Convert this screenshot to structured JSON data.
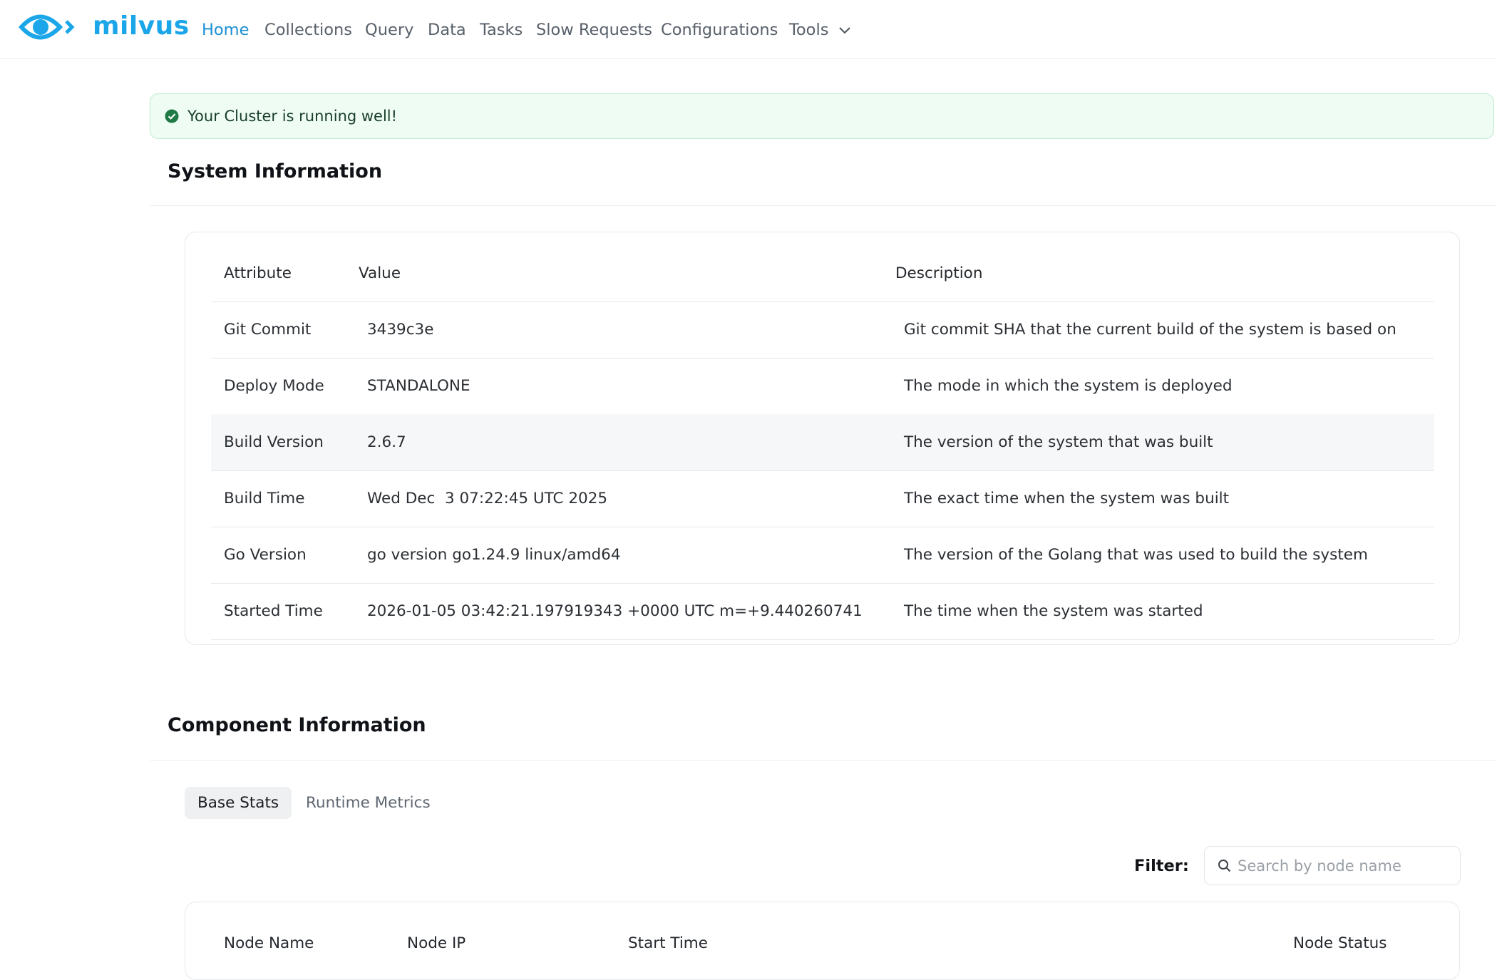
{
  "brand": {
    "name": "milvus",
    "color": "#1aa6e8"
  },
  "nav": {
    "items": [
      {
        "label": "Home"
      },
      {
        "label": "Collections"
      },
      {
        "label": "Query"
      },
      {
        "label": "Data"
      },
      {
        "label": "Tasks"
      },
      {
        "label": "Slow Requests"
      },
      {
        "label": "Configurations"
      },
      {
        "label": "Tools"
      }
    ],
    "active": "Home"
  },
  "alert": {
    "text": "Your Cluster is running well!",
    "status_color": "#1f7a45"
  },
  "system_info": {
    "title": "System Information",
    "headers": {
      "attribute": "Attribute",
      "value": "Value",
      "description": "Description"
    },
    "rows": [
      {
        "attribute": "Git Commit",
        "value": "3439c3e",
        "description": "Git commit SHA that the current build of the system is based on"
      },
      {
        "attribute": "Deploy Mode",
        "value": "STANDALONE",
        "description": "The mode in which the system is deployed"
      },
      {
        "attribute": "Build Version",
        "value": "2.6.7",
        "description": "The version of the system that was built"
      },
      {
        "attribute": "Build Time",
        "value": "Wed Dec  3 07:22:45 UTC 2025",
        "description": "The exact time when the system was built"
      },
      {
        "attribute": "Go Version",
        "value": "go version go1.24.9 linux/amd64",
        "description": "The version of the Golang that was used to build the system"
      },
      {
        "attribute": "Started Time",
        "value": "2026-01-05 03:42:21.197919343 +0000 UTC m=+9.440260741",
        "description": "The time when the system was started"
      }
    ]
  },
  "component_info": {
    "title": "Component Information",
    "tabs": [
      {
        "label": "Base Stats"
      },
      {
        "label": "Runtime Metrics"
      }
    ],
    "filter_label": "Filter:",
    "search_placeholder": "Search by node name",
    "headers": {
      "node_name": "Node Name",
      "node_ip": "Node IP",
      "start_time": "Start Time",
      "node_status": "Node Status"
    }
  }
}
